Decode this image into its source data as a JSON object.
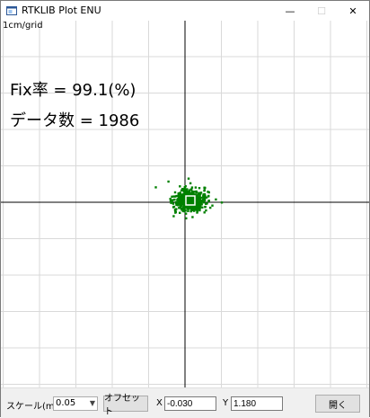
{
  "window": {
    "title": "RTKLIB Plot ENU",
    "minimize_glyph": "—",
    "maximize_glyph": "☐",
    "close_glyph": "✕"
  },
  "plot": {
    "grid_label": "1cm/grid",
    "fix_rate_text": "Fix率 = 99.1(%)",
    "data_count_text": "データ数 = 1986",
    "point_color": "#008000",
    "grid_color": "#d9d9d9",
    "axis_color": "#000000"
  },
  "toolbar": {
    "scale_label": "スケール(m)",
    "scale_value": "0.05",
    "offset_button": "オフセット",
    "x_label": "X",
    "x_value": "-0.030",
    "y_label": "Y",
    "y_value": "1.180",
    "open_button": "開く"
  }
}
